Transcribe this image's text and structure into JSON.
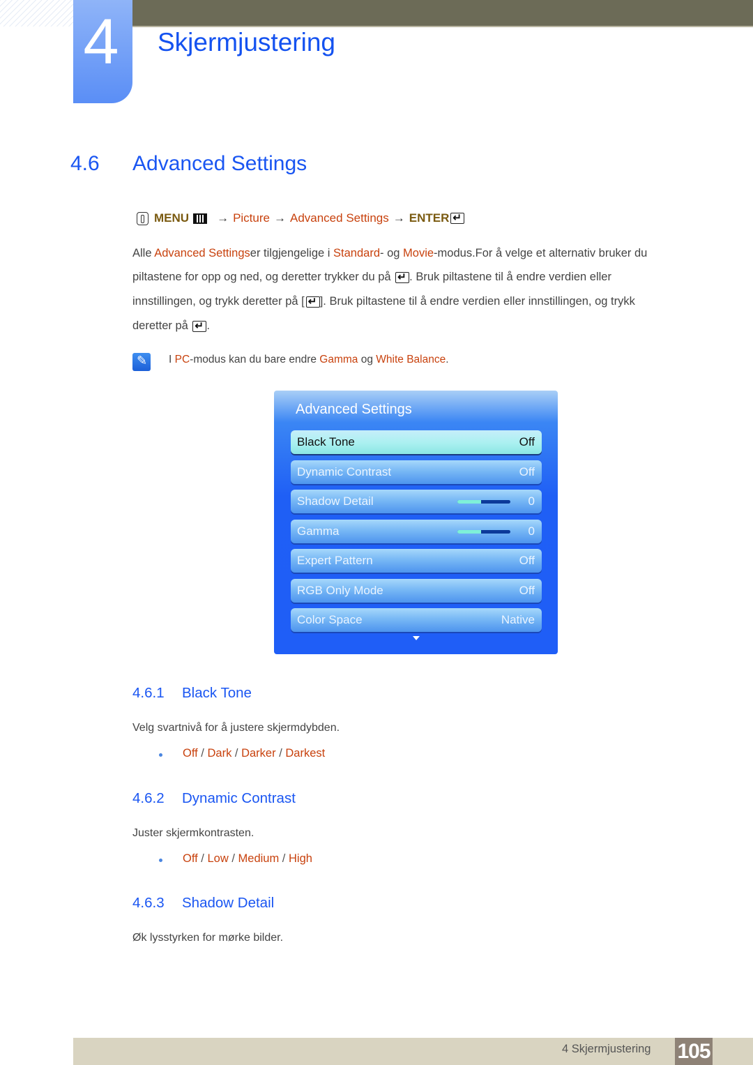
{
  "header": {
    "chapter_number": "4",
    "chapter_title": "Skjermjustering"
  },
  "section": {
    "number": "4.6",
    "title": "Advanced Settings"
  },
  "menu_path": {
    "menu_label": "MENU",
    "arrow": "→",
    "items": [
      "Picture",
      "Advanced Settings"
    ],
    "enter_label": "ENTER",
    "icons": [
      "hand-remote-icon",
      "menu-icon",
      "enter-icon"
    ]
  },
  "intro": {
    "line1": {
      "t1": "Alle ",
      "h1": "Advanced Settings",
      "t2": "er tilgjengelige i ",
      "h2": "Standard",
      "t3": "- og ",
      "h3": "Movie",
      "t4": "-modus.For å velge et alternativ bruker du"
    },
    "line2": {
      "t1": "piltastene for opp og ned, og deretter trykker du på ",
      "t2": ". Bruk piltastene til å endre verdien eller"
    },
    "line3": {
      "t1": "innstillingen, og trykk deretter på [",
      "t2": "]. Bruk piltastene til å endre verdien eller innstillingen, og trykk"
    },
    "line4": {
      "t1": "deretter på ",
      "t2": "."
    }
  },
  "note": {
    "icon": "note-pencil-icon",
    "t1": "I ",
    "h1": "PC",
    "t2": "-modus kan du bare endre ",
    "h2": "Gamma",
    "t3": " og ",
    "h3": "White Balance",
    "t4": "."
  },
  "osd": {
    "title": "Advanced Settings",
    "items": [
      {
        "label": "Black Tone",
        "value": "Off",
        "selected": true
      },
      {
        "label": "Dynamic Contrast",
        "value": "Off"
      },
      {
        "label": "Shadow Detail",
        "value": "0",
        "slider_fraction": 0.45
      },
      {
        "label": "Gamma",
        "value": "0",
        "slider_fraction": 0.45
      },
      {
        "label": "Expert Pattern",
        "value": "Off"
      },
      {
        "label": "RGB Only Mode",
        "value": "Off"
      },
      {
        "label": "Color Space",
        "value": "Native"
      }
    ],
    "more_indicator": "chevron-down-icon"
  },
  "subsections": [
    {
      "number": "4.6.1",
      "title": "Black Tone",
      "description": "Velg svartnivå for å justere skjermdybden.",
      "options": [
        "Off",
        "Dark",
        "Darker",
        "Darkest"
      ]
    },
    {
      "number": "4.6.2",
      "title": "Dynamic Contrast",
      "description": "Juster skjermkontrasten.",
      "options": [
        "Off",
        "Low",
        "Medium",
        "High"
      ]
    },
    {
      "number": "4.6.3",
      "title": "Shadow Detail",
      "description": "Øk lysstyrken for mørke bilder."
    }
  ],
  "footer": {
    "chapter_label": "4 Skjermjustering",
    "page_number": "105"
  },
  "colors": {
    "heading_blue": "#1a56f2",
    "highlight_orange": "#c8420e",
    "menu_gold": "#7a5a10",
    "top_bar": "#6c6b57",
    "footer_bar": "#d9d4c1",
    "page_box": "#8e8276",
    "osd_blue": "#1f5ef7"
  }
}
